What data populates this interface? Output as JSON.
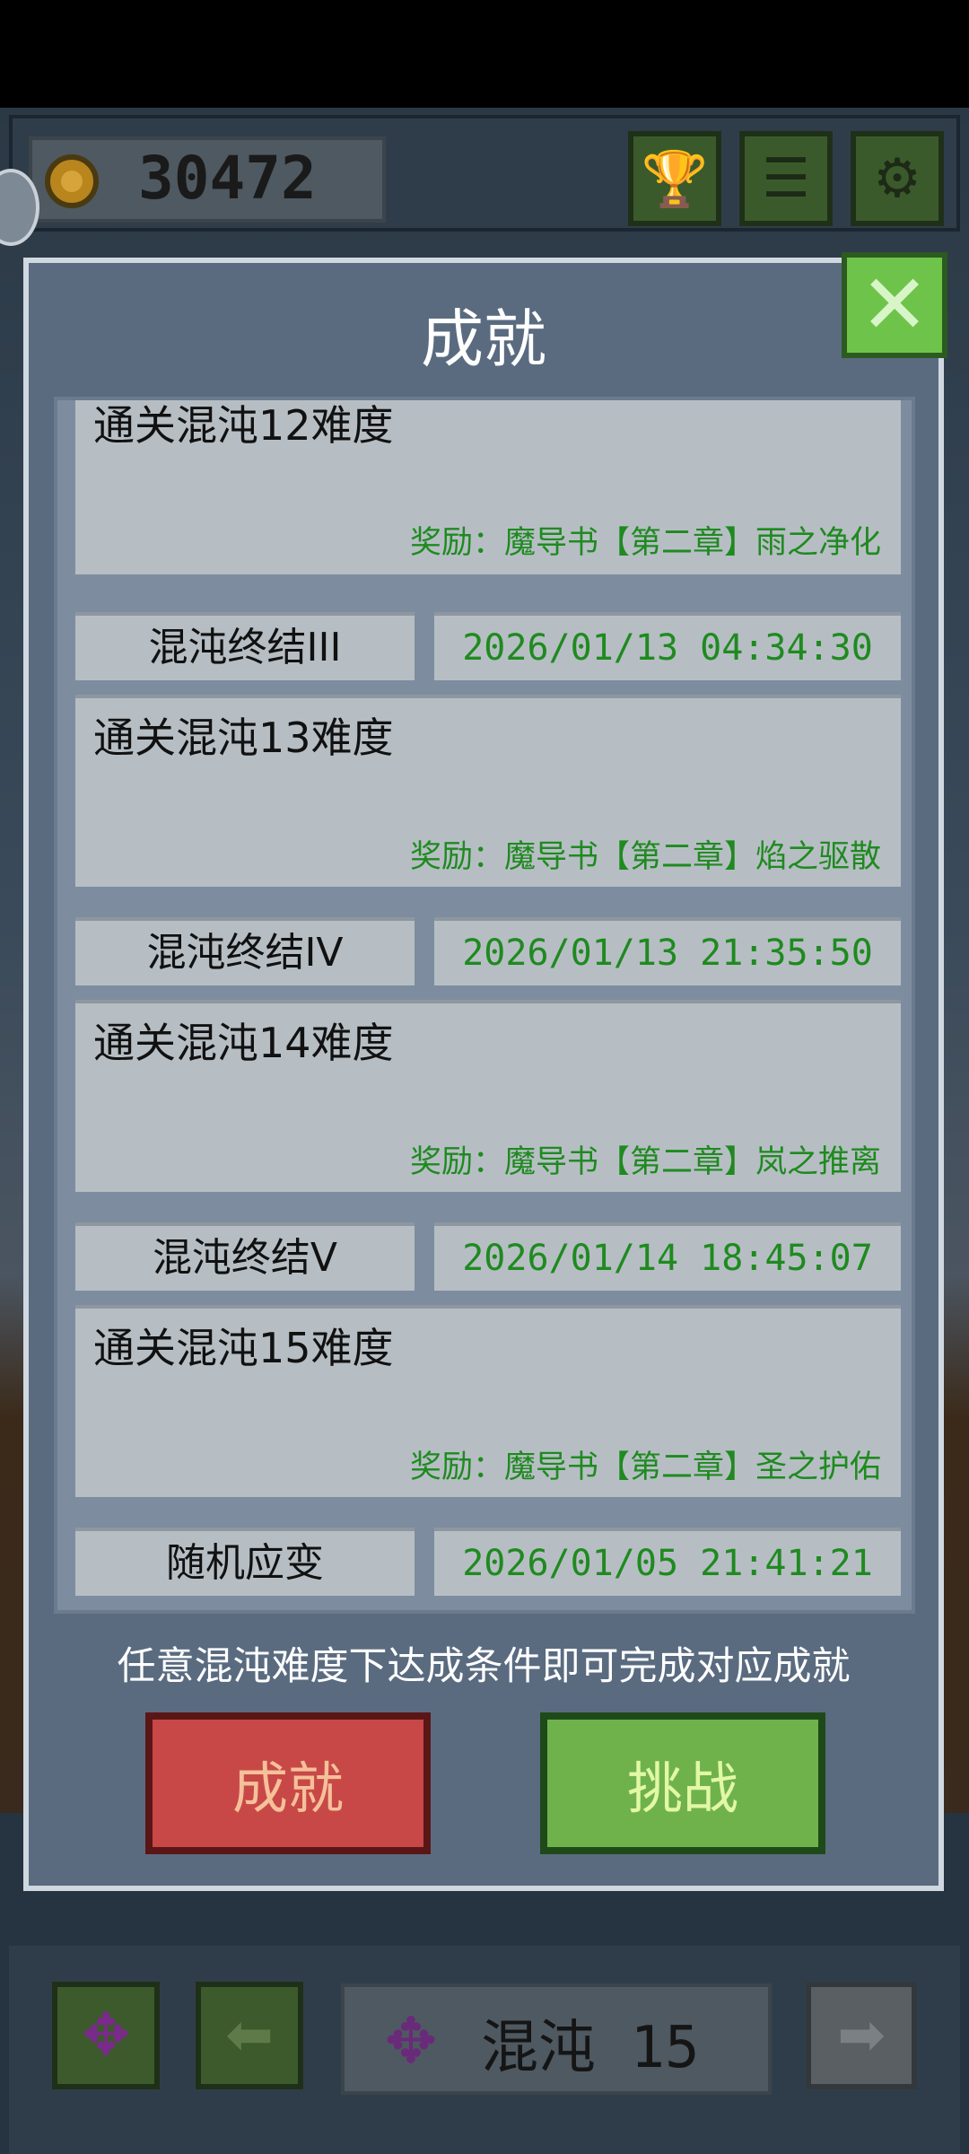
{
  "top_bar": {
    "coins": "30472",
    "buttons": [
      {
        "name": "trophy",
        "icon": "trophy-icon",
        "glyph": "🏆"
      },
      {
        "name": "list",
        "icon": "list-icon",
        "glyph": "☰"
      },
      {
        "name": "settings",
        "icon": "gear-icon",
        "glyph": "⚙"
      }
    ]
  },
  "dialog": {
    "title": "成就",
    "close_glyph": "✕",
    "hint": "任意混沌难度下达成条件即可完成对应成就",
    "achievement_button": "成就",
    "challenge_button": "挑战",
    "first_card": {
      "description": "通关混沌12难度",
      "reward": "奖励：魔导书【第二章】雨之净化"
    },
    "achievements": [
      {
        "name": "混沌终结III",
        "date": "2026/01/13 04:34:30",
        "description": "通关混沌13难度",
        "reward": "奖励：魔导书【第二章】焰之驱散"
      },
      {
        "name": "混沌终结IV",
        "date": "2026/01/13 21:35:50",
        "description": "通关混沌14难度",
        "reward": "奖励：魔导书【第二章】岚之推离"
      },
      {
        "name": "混沌终结V",
        "date": "2026/01/14 18:45:07",
        "description": "通关混沌15难度",
        "reward": "奖励：魔导书【第二章】圣之护佑"
      },
      {
        "name": "随机应变",
        "date": "2026/01/05 21:41:21"
      }
    ]
  },
  "bottom_bar": {
    "level_label": "混沌 15",
    "rune_glyph": "✥",
    "left_glyph": "⬅",
    "right_glyph": "➡"
  },
  "colors": {
    "dialog_bg": "#5a6b80",
    "card_bg": "#b6bec4",
    "reward_green": "#1f8a1f",
    "achievement_button_red": "#c84848",
    "challenge_button_green": "#6fb24c",
    "close_button_green": "#6ec44a"
  }
}
